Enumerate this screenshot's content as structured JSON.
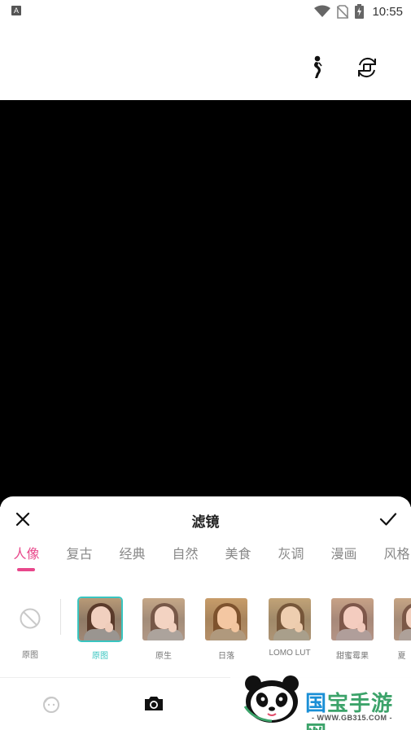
{
  "status_bar": {
    "time": "10:55",
    "app_badge": "A"
  },
  "sheet": {
    "title": "滤镜"
  },
  "categories": [
    "人像",
    "复古",
    "经典",
    "自然",
    "美食",
    "灰调",
    "漫画",
    "风格"
  ],
  "active_category": "人像",
  "none_filter": {
    "label": "原图"
  },
  "filters": [
    {
      "label": "原图",
      "selected": true,
      "tint": "rgba(255,255,255,0)"
    },
    {
      "label": "原生",
      "selected": false,
      "tint": "rgba(255,230,210,0.18)"
    },
    {
      "label": "日落",
      "selected": false,
      "tint": "rgba(255,170,60,0.22)"
    },
    {
      "label": "LOMO LUT",
      "selected": false,
      "tint": "rgba(230,200,120,0.2)"
    },
    {
      "label": "甜蜜霉果",
      "selected": false,
      "tint": "rgba(255,190,190,0.22)"
    },
    {
      "label": "夏",
      "selected": false,
      "tint": "rgba(255,210,190,0.2)"
    }
  ],
  "colors": {
    "accent_pink": "#e8478b",
    "selected_teal": "#39c5c0",
    "camera_bg": "#000000"
  },
  "watermark": {
    "brand_accent": "国",
    "brand_rest": "宝手游网",
    "url": "- WWW.GB315.COM -"
  }
}
